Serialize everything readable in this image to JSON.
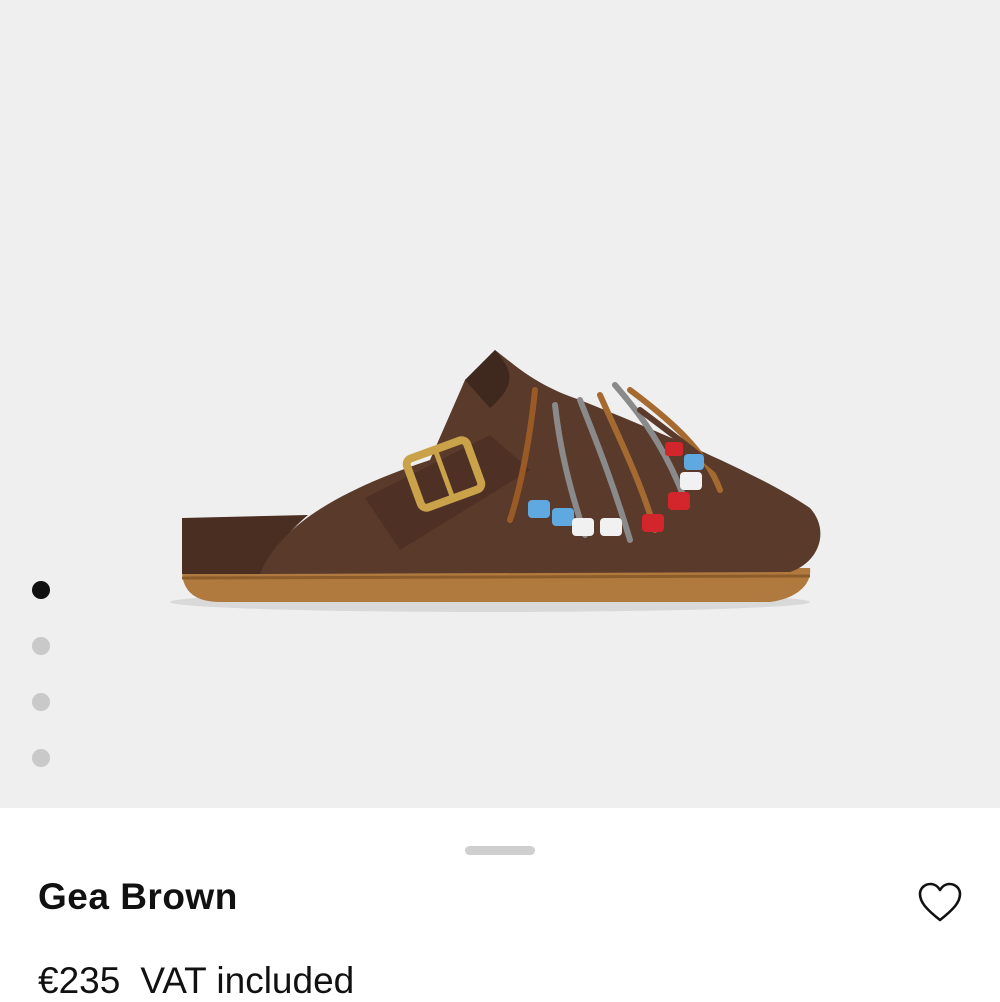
{
  "gallery": {
    "image_alt": "Gea Brown",
    "pagination": {
      "total": 4,
      "active": 1
    }
  },
  "product": {
    "name": "Gea Brown",
    "price": "€235",
    "vat_note": "VAT included"
  },
  "icons": {
    "wishlist": "heart-outline-icon",
    "sheet_handle": "drag-handle"
  },
  "colors": {
    "gallery_bg": "#efefef",
    "dot_active": "#111111",
    "dot_inactive": "#c9c9c9",
    "text": "#111111"
  }
}
